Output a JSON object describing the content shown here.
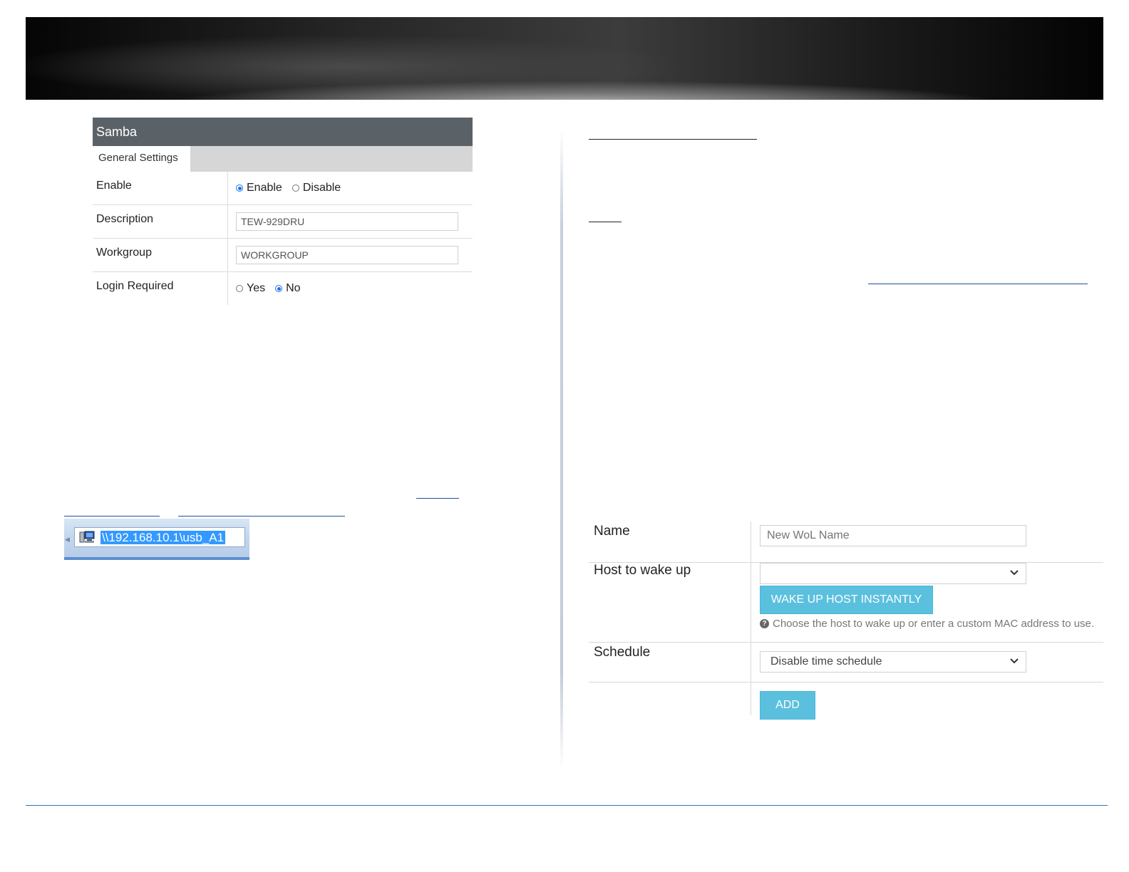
{
  "samba": {
    "title": "Samba",
    "tab": "General Settings",
    "rows": {
      "enable": {
        "label": "Enable",
        "options": [
          "Enable",
          "Disable"
        ],
        "selected": "Enable"
      },
      "description": {
        "label": "Description",
        "value": "TEW-929DRU"
      },
      "workgroup": {
        "label": "Workgroup",
        "value": "WORKGROUP"
      },
      "login_required": {
        "label": "Login Required",
        "options": [
          "Yes",
          "No"
        ],
        "selected": "No"
      }
    }
  },
  "address_bar": {
    "path": "\\\\192.168.10.1\\usb_A1",
    "icon": "computer-icon"
  },
  "wol": {
    "name": {
      "label": "Name",
      "placeholder": "New WoL Name"
    },
    "host": {
      "label": "Host to wake up",
      "selected": "",
      "button": "WAKE UP HOST INSTANTLY",
      "help": "Choose the host to wake up or enter a custom MAC address to use."
    },
    "schedule": {
      "label": "Schedule",
      "selected": "Disable time schedule"
    },
    "add_button": "ADD"
  },
  "colors": {
    "samba_header": "#5b6267",
    "tab_strip": "#d6d6d6",
    "radio_checked": "#1a73e8",
    "button": "#5bc0de",
    "footer_rule": "#2e75b6",
    "selection": "#3399ff"
  }
}
